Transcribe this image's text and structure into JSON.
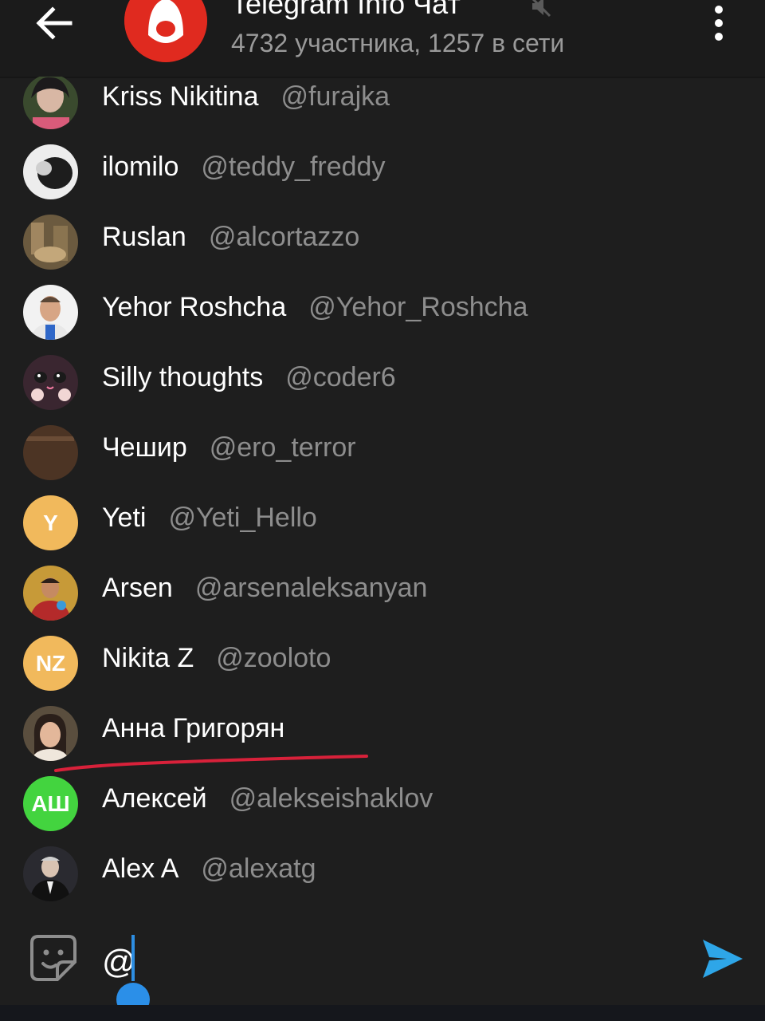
{
  "header": {
    "title": "Telegram Info Чат",
    "subtitle": "4732 участника, 1257 в сети",
    "back_icon": "arrow-left-icon",
    "mute_icon": "speaker-muted-icon",
    "more_icon": "more-vertical-icon"
  },
  "members": [
    {
      "name": "Kriss Nikitina",
      "handle": "@furajka"
    },
    {
      "name": "ilomilo",
      "handle": "@teddy_freddy"
    },
    {
      "name": "Ruslan",
      "handle": "@alcortazzo"
    },
    {
      "name": "Yehor Roshcha",
      "handle": "@Yehor_Roshcha"
    },
    {
      "name": "Silly thoughts",
      "handle": "@coder6"
    },
    {
      "name": "Чешир",
      "handle": "@ero_terror"
    },
    {
      "name": "Yeti",
      "handle": "@Yeti_Hello",
      "initials": "Y",
      "avatar_color": "#f1b95c"
    },
    {
      "name": "Arsen",
      "handle": "@arsenaleksanyan"
    },
    {
      "name": "Nikita Z",
      "handle": "@zooloto",
      "initials": "NZ",
      "avatar_color": "#f1b95c"
    },
    {
      "name": "Анна Григорян",
      "handle": ""
    },
    {
      "name": "Алексей",
      "handle": "@alekseishaklov",
      "initials": "АШ",
      "avatar_color": "#43d43f"
    },
    {
      "name": "Alex A",
      "handle": "@alexatg"
    }
  ],
  "composer": {
    "input_value": "@",
    "sticker_icon": "sticker-icon",
    "send_icon": "send-icon"
  },
  "colors": {
    "background": "#1e1e1e",
    "accent": "#2b8fe8",
    "highlight_underline": "#d8213a"
  }
}
